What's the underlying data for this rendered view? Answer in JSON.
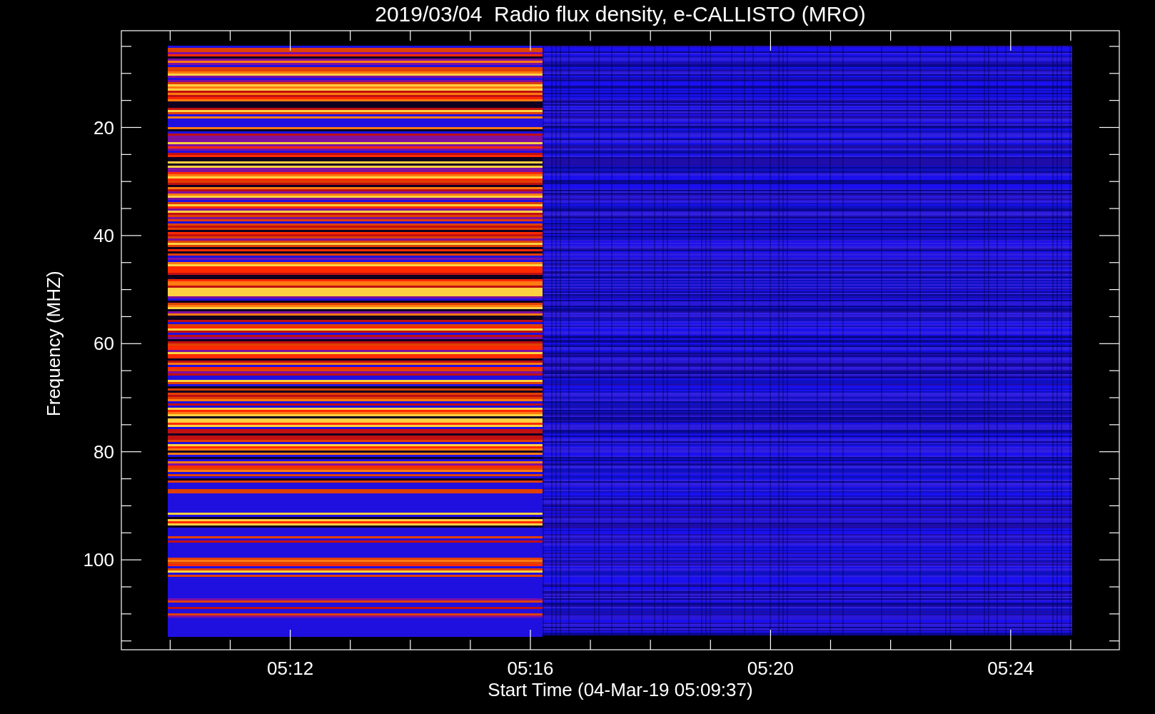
{
  "plot": {
    "title": "2019/03/04  Radio flux density, e-CALLISTO (MRO)",
    "xlabel": "Start Time (04-Mar-19 05:09:37)",
    "ylabel": "Frequency (MHZ)",
    "xticks": [
      "05:12",
      "05:16",
      "05:20",
      "05:24"
    ],
    "yticks": [
      "20",
      "40",
      "60",
      "80",
      "100"
    ]
  }
}
